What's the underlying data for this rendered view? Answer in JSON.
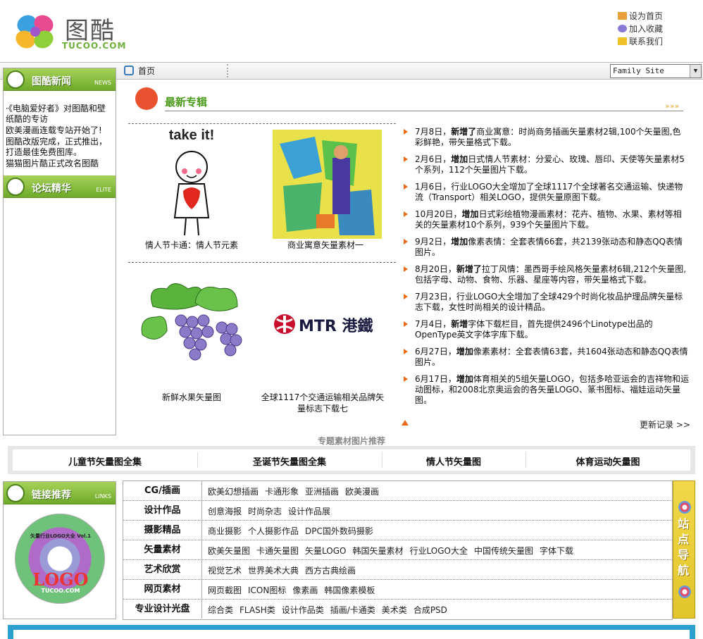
{
  "header": {
    "logo_text": "图酷",
    "logo_sub": "TUCOO.COM",
    "top_links": [
      "设为首页",
      "加入收藏",
      "联系我们"
    ]
  },
  "nav": {
    "home": "首页",
    "site_select": "Family Site"
  },
  "sidebar": {
    "news_title": "图酷新闻",
    "news_en": "NEWS",
    "news_items": [
      "·《电脑爱好者》对图酷和壁纸酷的专访",
      "欧美漫画连载专站开始了!",
      "图酷改版完成，正式推出，打造最佳免费图库。",
      "猫猫图片酷正式改名图酷"
    ],
    "forum_title": "论坛精华",
    "forum_en": "ELITE"
  },
  "feature": {
    "title": "最新专辑",
    "more": "»»»",
    "cells": [
      {
        "caption": "情人节卡通：情人节元素",
        "art": "take it!"
      },
      {
        "caption": "商业寓意矢量素材一"
      },
      {
        "caption": "新鲜水果矢量图"
      },
      {
        "caption": "全球1117个交通运输相关品牌矢量标志下载七",
        "art": "MTR 港鐵"
      }
    ]
  },
  "updates": [
    {
      "date": "7月8日，",
      "verb": "新增了",
      "text": "商业寓意：时尚商务插画矢量素材2辑,100个矢量图,色彩鲜艳，带矢量格式下载。"
    },
    {
      "date": "2月6日，",
      "verb": "增加",
      "text": "日式情人节素材：分爱心、玫瑰、唇印、天使等矢量素材5个系列，112个矢量图片下载。"
    },
    {
      "date": "1月6日，",
      "verb": "",
      "text": "行业LOGO大全增加了全球1117个全球著名交通运输、快递物流（Transport）相关LOGO，提供矢量原图下载。"
    },
    {
      "date": "10月20日，",
      "verb": "增加",
      "text": "日式彩绘植物漫画素材：花卉、植物、水果、素材等相关的矢量素材10个系列，939个矢量图片下载。"
    },
    {
      "date": "9月2日，",
      "verb": "增加",
      "text": "像素表情：全套表情66套，共2139张动态和静态QQ表情图片。"
    },
    {
      "date": "8月20日，",
      "verb": "新增了",
      "text": "拉丁风情：墨西哥手绘风格矢量素材6辑,212个矢量图,包括字母、动物、食物、乐器、星座等内容，带矢量格式下载。"
    },
    {
      "date": "7月23日，",
      "verb": "",
      "text": "行业LOGO大全增加了全球429个时尚化妆品护理品牌矢量标志下载，女性时尚相关的设计精品。"
    },
    {
      "date": "7月4日，",
      "verb": "新增",
      "text": "字体下载栏目，首先提供2496个Linotype出品的OpenType英文字体字库下载。"
    },
    {
      "date": "6月27日，",
      "verb": "增加",
      "text": "像素素材：全套表情63套，共1604张动态和静态QQ表情图片。"
    },
    {
      "date": "6月17日，",
      "verb": "增加",
      "text": "体育相关的5组矢量LOGO，包括多哈亚运会的吉祥物和运动图标，和2008北京奥运会的各矢量LOGO、篆书图标、福娃运动矢量图。"
    }
  ],
  "more_records": "更新记录 >>",
  "recommend": {
    "title": "专题素材图片推荐",
    "items": [
      "儿童节矢量图全集",
      "圣诞节矢量图全集",
      "情人节矢量图",
      "体育运动矢量图"
    ]
  },
  "links": {
    "title": "链接推荐",
    "en": "LINKS",
    "cd_label": "矢量行业LOGO大全 Vol.1",
    "cd_logo": "LOGO",
    "cd_site": "TUCOO.COM",
    "rows": [
      {
        "cat": "CG/插画",
        "items": [
          "欧美幻想插画",
          "卡通形象",
          "亚洲插画",
          "欧美漫画"
        ]
      },
      {
        "cat": "设计作品",
        "items": [
          "创意海报",
          "时尚杂志",
          "设计作品展"
        ]
      },
      {
        "cat": "摄影精品",
        "items": [
          "商业摄影",
          "个人摄影作品",
          "DPC国外数码摄影"
        ]
      },
      {
        "cat": "矢量素材",
        "items": [
          "欧美矢量图",
          "卡通矢量图",
          "矢量LOGO",
          "韩国矢量素材",
          "行业LOGO大全",
          "中国传统矢量图",
          "字体下载"
        ]
      },
      {
        "cat": "艺术欣赏",
        "items": [
          "视觉艺术",
          "世界美术大典",
          "西方古典绘画"
        ]
      },
      {
        "cat": "网页素材",
        "items": [
          "网页截图",
          "ICON图标",
          "像素画",
          "韩国像素模板"
        ]
      },
      {
        "cat": "专业设计光盘",
        "items": [
          "综合类",
          "FLASH类",
          "设计作品类",
          "插画/卡通类",
          "美术类",
          "合成PSD"
        ]
      }
    ],
    "side_nav": "站点导航"
  }
}
